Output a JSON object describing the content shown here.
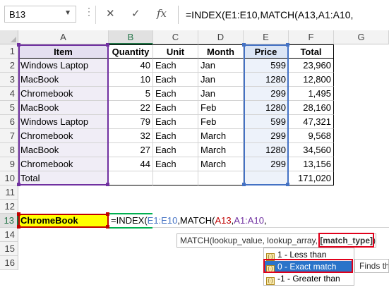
{
  "formula_bar": {
    "name_box": "B13",
    "cancel_glyph": "✕",
    "enter_glyph": "✓",
    "fx_glyph": "fx",
    "formula": "=INDEX(E1:E10,MATCH(A13,A1:A10,"
  },
  "columns": [
    "A",
    "B",
    "C",
    "D",
    "E",
    "F",
    "G"
  ],
  "rows": [
    "1",
    "2",
    "3",
    "4",
    "5",
    "6",
    "7",
    "8",
    "9",
    "10",
    "11",
    "12",
    "13",
    "14",
    "15",
    "16"
  ],
  "table": {
    "headers": [
      "Item",
      "Quantity",
      "Unit",
      "Month",
      "Price",
      "Total"
    ],
    "data": [
      [
        "Windows Laptop",
        "40",
        "Each",
        "Jan",
        "599",
        "23,960"
      ],
      [
        "MacBook",
        "10",
        "Each",
        "Jan",
        "1280",
        "12,800"
      ],
      [
        "Chromebook",
        "5",
        "Each",
        "Jan",
        "299",
        "1,495"
      ],
      [
        "MacBook",
        "22",
        "Each",
        "Feb",
        "1280",
        "28,160"
      ],
      [
        "Windows Laptop",
        "79",
        "Each",
        "Feb",
        "599",
        "47,321"
      ],
      [
        "Chromebook",
        "32",
        "Each",
        "March",
        "299",
        "9,568"
      ],
      [
        "MacBook",
        "27",
        "Each",
        "March",
        "1280",
        "34,560"
      ],
      [
        "Chromebook",
        "44",
        "Each",
        "March",
        "299",
        "13,156"
      ]
    ],
    "total_label": "Total",
    "total_value": "171,020"
  },
  "lookup": {
    "label": "ChromeBook",
    "formula_prefix": "=INDEX(",
    "ref1": "E1:E10",
    "mid": ",MATCH(",
    "ref2": "A13",
    "sep": ",",
    "ref3": "A1:A10",
    "suffix": ","
  },
  "tooltip": {
    "prefix": "MATCH(lookup_value, lookup_array, ",
    "active_arg": "[match_type]",
    "suffix": ")"
  },
  "dropdown": {
    "items": [
      "1 - Less than",
      "0 - Exact match",
      "-1 - Greater than"
    ],
    "selected_index": 1,
    "description": "Finds the"
  },
  "colors": {
    "range_blue": "#4472c4",
    "range_purple": "#7030a0",
    "range_red": "#c00000",
    "range_green": "#00b050",
    "header_fill_blue": "#dbe5f5",
    "header_fill_purple": "#e4dff0",
    "active_green": "#217346",
    "yellow": "#ffff00",
    "highlight_red": "#e0001b"
  }
}
